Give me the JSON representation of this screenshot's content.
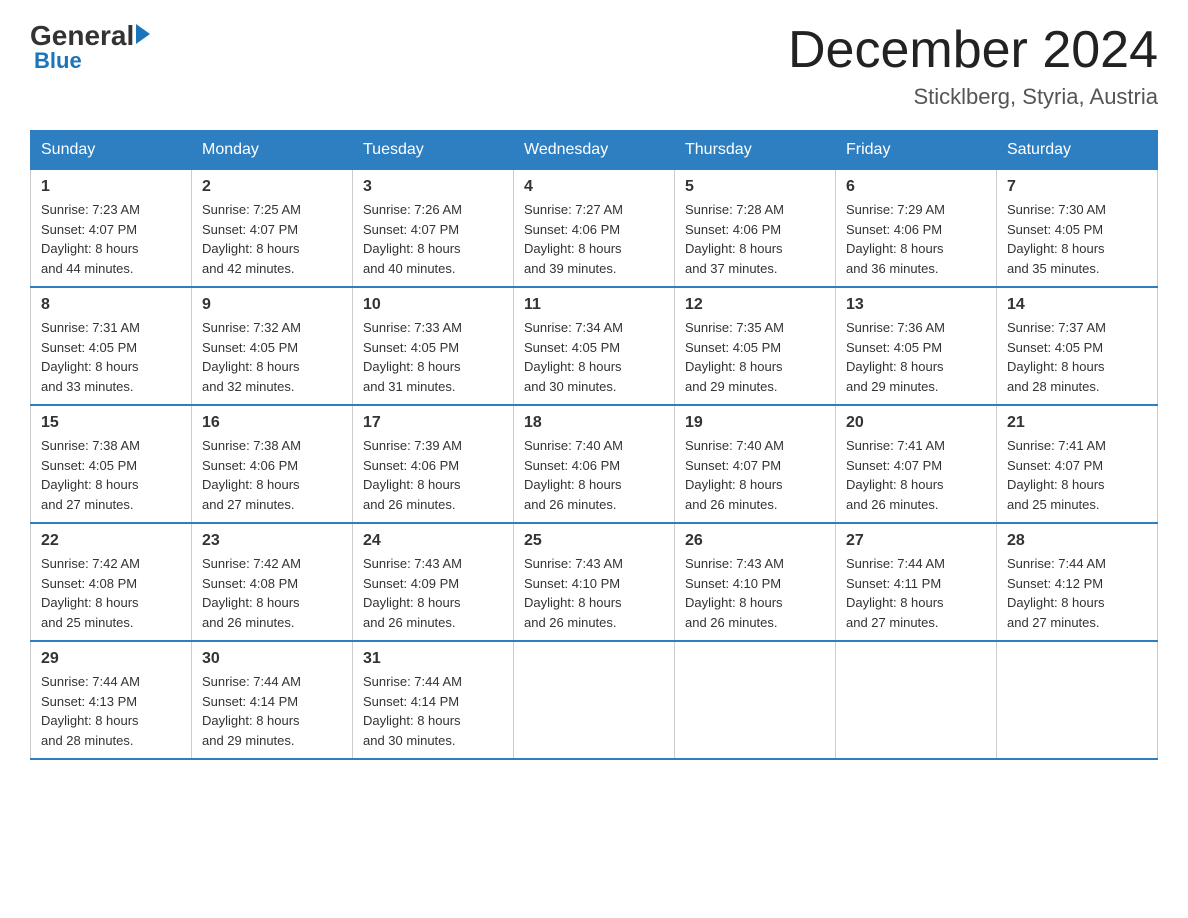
{
  "header": {
    "logo": {
      "general": "General",
      "arrow": "",
      "blue": "Blue"
    },
    "title": "December 2024",
    "location": "Sticklberg, Styria, Austria"
  },
  "days_of_week": [
    "Sunday",
    "Monday",
    "Tuesday",
    "Wednesday",
    "Thursday",
    "Friday",
    "Saturday"
  ],
  "weeks": [
    [
      {
        "day": "1",
        "sunrise": "7:23 AM",
        "sunset": "4:07 PM",
        "daylight": "8 hours and 44 minutes."
      },
      {
        "day": "2",
        "sunrise": "7:25 AM",
        "sunset": "4:07 PM",
        "daylight": "8 hours and 42 minutes."
      },
      {
        "day": "3",
        "sunrise": "7:26 AM",
        "sunset": "4:07 PM",
        "daylight": "8 hours and 40 minutes."
      },
      {
        "day": "4",
        "sunrise": "7:27 AM",
        "sunset": "4:06 PM",
        "daylight": "8 hours and 39 minutes."
      },
      {
        "day": "5",
        "sunrise": "7:28 AM",
        "sunset": "4:06 PM",
        "daylight": "8 hours and 37 minutes."
      },
      {
        "day": "6",
        "sunrise": "7:29 AM",
        "sunset": "4:06 PM",
        "daylight": "8 hours and 36 minutes."
      },
      {
        "day": "7",
        "sunrise": "7:30 AM",
        "sunset": "4:05 PM",
        "daylight": "8 hours and 35 minutes."
      }
    ],
    [
      {
        "day": "8",
        "sunrise": "7:31 AM",
        "sunset": "4:05 PM",
        "daylight": "8 hours and 33 minutes."
      },
      {
        "day": "9",
        "sunrise": "7:32 AM",
        "sunset": "4:05 PM",
        "daylight": "8 hours and 32 minutes."
      },
      {
        "day": "10",
        "sunrise": "7:33 AM",
        "sunset": "4:05 PM",
        "daylight": "8 hours and 31 minutes."
      },
      {
        "day": "11",
        "sunrise": "7:34 AM",
        "sunset": "4:05 PM",
        "daylight": "8 hours and 30 minutes."
      },
      {
        "day": "12",
        "sunrise": "7:35 AM",
        "sunset": "4:05 PM",
        "daylight": "8 hours and 29 minutes."
      },
      {
        "day": "13",
        "sunrise": "7:36 AM",
        "sunset": "4:05 PM",
        "daylight": "8 hours and 29 minutes."
      },
      {
        "day": "14",
        "sunrise": "7:37 AM",
        "sunset": "4:05 PM",
        "daylight": "8 hours and 28 minutes."
      }
    ],
    [
      {
        "day": "15",
        "sunrise": "7:38 AM",
        "sunset": "4:05 PM",
        "daylight": "8 hours and 27 minutes."
      },
      {
        "day": "16",
        "sunrise": "7:38 AM",
        "sunset": "4:06 PM",
        "daylight": "8 hours and 27 minutes."
      },
      {
        "day": "17",
        "sunrise": "7:39 AM",
        "sunset": "4:06 PM",
        "daylight": "8 hours and 26 minutes."
      },
      {
        "day": "18",
        "sunrise": "7:40 AM",
        "sunset": "4:06 PM",
        "daylight": "8 hours and 26 minutes."
      },
      {
        "day": "19",
        "sunrise": "7:40 AM",
        "sunset": "4:07 PM",
        "daylight": "8 hours and 26 minutes."
      },
      {
        "day": "20",
        "sunrise": "7:41 AM",
        "sunset": "4:07 PM",
        "daylight": "8 hours and 26 minutes."
      },
      {
        "day": "21",
        "sunrise": "7:41 AM",
        "sunset": "4:07 PM",
        "daylight": "8 hours and 25 minutes."
      }
    ],
    [
      {
        "day": "22",
        "sunrise": "7:42 AM",
        "sunset": "4:08 PM",
        "daylight": "8 hours and 25 minutes."
      },
      {
        "day": "23",
        "sunrise": "7:42 AM",
        "sunset": "4:08 PM",
        "daylight": "8 hours and 26 minutes."
      },
      {
        "day": "24",
        "sunrise": "7:43 AM",
        "sunset": "4:09 PM",
        "daylight": "8 hours and 26 minutes."
      },
      {
        "day": "25",
        "sunrise": "7:43 AM",
        "sunset": "4:10 PM",
        "daylight": "8 hours and 26 minutes."
      },
      {
        "day": "26",
        "sunrise": "7:43 AM",
        "sunset": "4:10 PM",
        "daylight": "8 hours and 26 minutes."
      },
      {
        "day": "27",
        "sunrise": "7:44 AM",
        "sunset": "4:11 PM",
        "daylight": "8 hours and 27 minutes."
      },
      {
        "day": "28",
        "sunrise": "7:44 AM",
        "sunset": "4:12 PM",
        "daylight": "8 hours and 27 minutes."
      }
    ],
    [
      {
        "day": "29",
        "sunrise": "7:44 AM",
        "sunset": "4:13 PM",
        "daylight": "8 hours and 28 minutes."
      },
      {
        "day": "30",
        "sunrise": "7:44 AM",
        "sunset": "4:14 PM",
        "daylight": "8 hours and 29 minutes."
      },
      {
        "day": "31",
        "sunrise": "7:44 AM",
        "sunset": "4:14 PM",
        "daylight": "8 hours and 30 minutes."
      },
      null,
      null,
      null,
      null
    ]
  ],
  "labels": {
    "sunrise": "Sunrise:",
    "sunset": "Sunset:",
    "daylight": "Daylight:"
  }
}
